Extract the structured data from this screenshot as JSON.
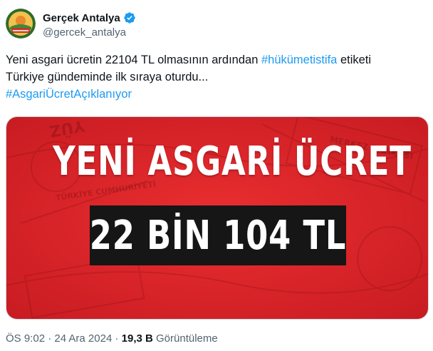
{
  "tweet": {
    "author": {
      "display_name": "Gerçek Antalya",
      "handle": "@gercek_antalya",
      "verified": true,
      "avatar_text": "GERÇEK ANTALYA"
    },
    "text": {
      "line1_before": "Yeni asgari ücretin 22104 TL olmasının ardından ",
      "line1_hashtag": "#hükümetistifa",
      "line1_after": " etiketi",
      "line2": "Türkiye gündeminde ilk sıraya oturdu...",
      "line3_hashtag": "#AsgariÜcretAçıklanıyor"
    },
    "media": {
      "headline": "YENİ ASGARİ ÜCRET",
      "amount": "22 BİN 104 TL",
      "background_text_1": "MERKEZ BANKASI",
      "background_text_2": "TÜRKİYE CUMHURİYETİ",
      "background_text_3": "YÜZ"
    },
    "footer": {
      "time": "ÖS 9:02",
      "separator": " · ",
      "date": "24 Ara 2024",
      "views_count": "19,3 B",
      "views_label": " Görüntüleme"
    }
  },
  "colors": {
    "hashtag": "#1d9bf0",
    "muted": "#536471",
    "verified": "#1d9bf0",
    "media_red": "#e3262b",
    "amount_box": "#161616"
  }
}
